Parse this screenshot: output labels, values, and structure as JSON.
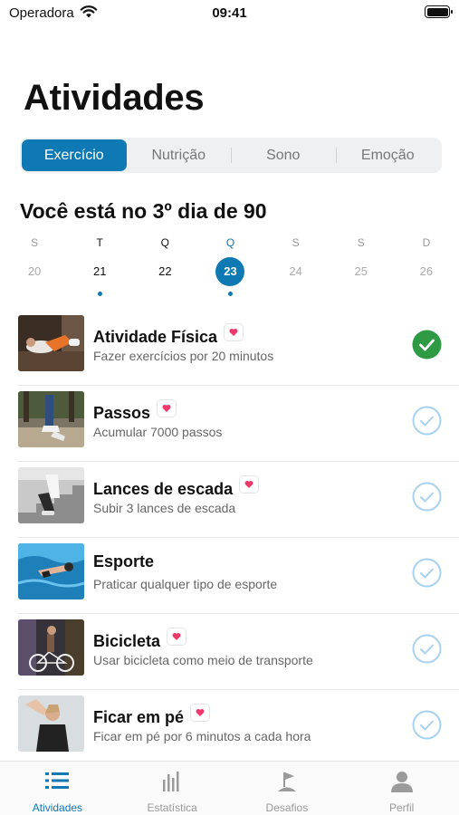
{
  "status_bar": {
    "carrier": "Operadora",
    "time": "09:41"
  },
  "page": {
    "title": "Atividades"
  },
  "segments": [
    {
      "label": "Exercício",
      "active": true
    },
    {
      "label": "Nutrição",
      "active": false
    },
    {
      "label": "Sono",
      "active": false
    },
    {
      "label": "Emoção",
      "active": false
    }
  ],
  "progress_title": "Você está no 3º dia de 90",
  "week": [
    {
      "letter": "S",
      "day": "20",
      "state": "past",
      "dot": false
    },
    {
      "letter": "T",
      "day": "21",
      "state": "strong",
      "dot": true
    },
    {
      "letter": "Q",
      "day": "22",
      "state": "strong",
      "dot": false
    },
    {
      "letter": "Q",
      "day": "23",
      "state": "today",
      "dot": true
    },
    {
      "letter": "S",
      "day": "24",
      "state": "future",
      "dot": false
    },
    {
      "letter": "S",
      "day": "25",
      "state": "future",
      "dot": false
    },
    {
      "letter": "D",
      "day": "26",
      "state": "future",
      "dot": false
    }
  ],
  "activities": [
    {
      "title": "Atividade Física",
      "subtitle": "Fazer exercícios por 20 minutos",
      "done": true,
      "image_icon": "workout-photo-icon"
    },
    {
      "title": "Passos",
      "subtitle": "Acumular 7000 passos",
      "done": false,
      "image_icon": "walking-photo-icon"
    },
    {
      "title": "Lances de escada",
      "subtitle": "Subir 3 lances de escada",
      "done": false,
      "image_icon": "stairs-photo-icon"
    },
    {
      "title": "Esporte",
      "subtitle": "Praticar qualquer tipo de esporte",
      "done": false,
      "image_icon": "swimming-photo-icon"
    },
    {
      "title": "Bicicleta",
      "subtitle": "Usar bicicleta como meio de transporte",
      "done": false,
      "image_icon": "cycling-photo-icon"
    },
    {
      "title": "Ficar em pé",
      "subtitle": "Ficar em pé por 6 minutos a cada hora",
      "done": false,
      "image_icon": "standing-photo-icon"
    }
  ],
  "tabs": [
    {
      "label": "Atividades",
      "icon": "list-icon",
      "active": true
    },
    {
      "label": "Estatística",
      "icon": "bar-chart-icon",
      "active": false
    },
    {
      "label": "Desafios",
      "icon": "flag-icon",
      "active": false
    },
    {
      "label": "Perfil",
      "icon": "person-icon",
      "active": false
    }
  ],
  "colors": {
    "accent": "#0e79b2",
    "done_green": "#2e9a44",
    "pending_ring": "#a9d2f0",
    "heart": "#f0386b"
  }
}
